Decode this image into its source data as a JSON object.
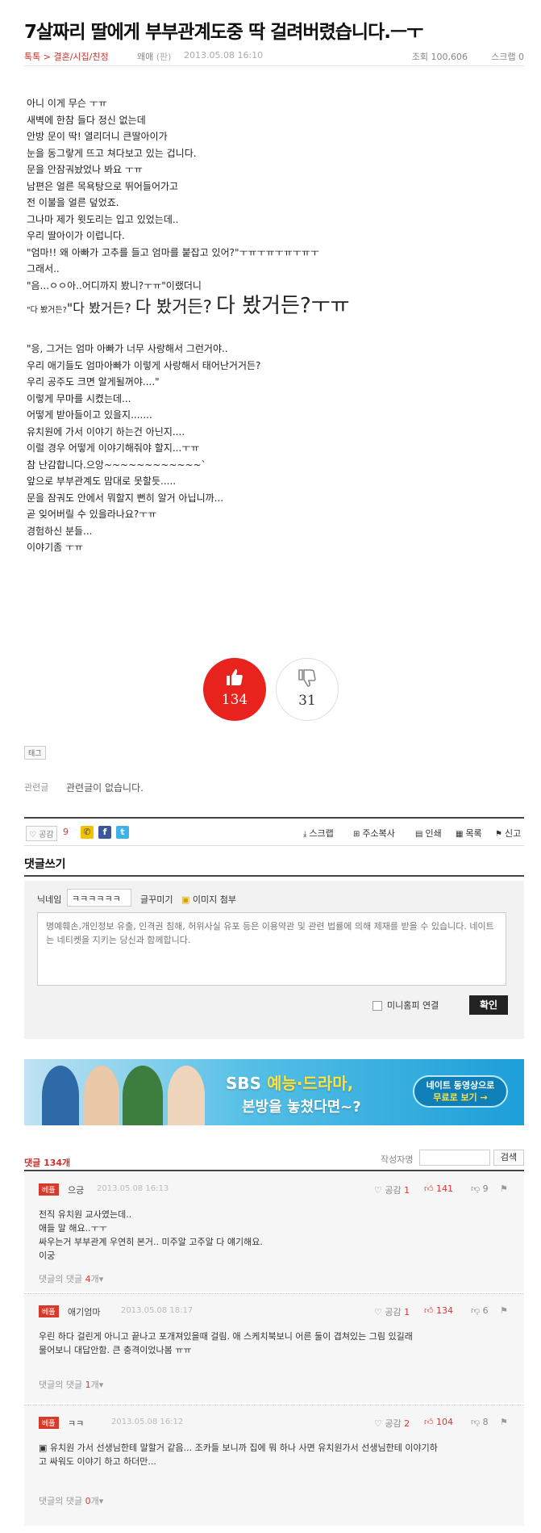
{
  "post": {
    "title": "7살짜리 딸에게 부부관계도중 딱 걸려버렸습니다.ㅡㅜ",
    "breadcrumb": "톡톡 > 결혼/시집/친정",
    "author": "왜애",
    "author_mark": "(판)",
    "date": "2013.05.08 16:10",
    "views": "조회 100,606",
    "scraps": "스크랩 0",
    "lines_1": [
      "아니 이게 무슨 ㅜㅠ",
      "새벽에 한참 들다 정신 없는데",
      "안방 문이 딱! 열리더니 큰딸아이가",
      "눈을 동그랗게 뜨고 쳐다보고 있는 겁니다.",
      "문을 안잠궈놨었나 봐요 ㅜㅠ",
      "남편은 얼른 목욕탕으로 뛰어들어가고",
      "전 이불을 얼른 덮었죠.",
      "그나마 제가 윗도리는 입고 있었는데..",
      "우리 딸아이가 이럽니다.",
      "\"엄마!! 왜 아빠가 고추를 들고 엄마를 붙잡고 있어?\"ㅜㅠㅜㅠㅜㅠㅜㅠㅜ",
      "그래서..",
      "\"음...ㅇㅇ아..어디까지 봤니?ㅜㅠ\"이랬더니"
    ],
    "growing": [
      "\"다 봤거든?",
      "\"다 봤거든?",
      "다 봤거든?",
      "다 봤거든?ㅜㅠ"
    ],
    "lines_2": [
      "\"응, 그거는 엄마 아빠가 너무 사랑해서 그런거야..",
      " 우리 애기들도 엄마아빠가 이렇게 사랑해서 태어난거거든?",
      " 우리 공주도 크면 알게될꺼야....\"",
      "  이렇게 무마를 시켰는데...",
      "어떻게 받아들이고 있을지.......",
      "유치원에 가서 이야기 하는건 아닌지....",
      "이럴 경우 어떻게 이야기해줘야 할지...ㅜㅠ",
      "참 난감합니다.으앙~~~~~~~~~~~~`",
      "앞으로 부부관계도 맘대로 못할듯.....",
      "문을 잠궈도 안에서 뭐할지 뻔히 알거 아닙니까...",
      "곧 잊어버릴 수 있을라나요?ㅜㅠ",
      "경험하신 분들...",
      "이야기좀 ㅜㅠ"
    ]
  },
  "votes": {
    "up": "134",
    "down": "31"
  },
  "tag_label": "태그",
  "related": {
    "label": "관련글",
    "text": "관련글이 없습니다."
  },
  "share": {
    "like_label": "공감",
    "like_count": "9",
    "scrap": "스크랩",
    "copy_url": "주소복사",
    "print": "인쇄",
    "list": "목록",
    "report": "신고"
  },
  "comment_write": {
    "title": "댓글쓰기",
    "nick_label": "닉네임",
    "nick_value": "ㅋㅋㅋㅋㅋㅋ",
    "format_label": "글꾸미기",
    "image_label": "이미지 첨부",
    "placeholder": "명예훼손,개인정보 유출, 인격권 침해, 허위사실 유포 등은 이용약관 및 관련 법률에 의해 제재를 받을 수 있습니다. 네이트는 네티켓을 지키는 당신과 함께합니다.",
    "minihp_label": "미니홈피 연결",
    "confirm": "확인"
  },
  "banner": {
    "main_a": "SBS ",
    "main_b": "예능·드라마,",
    "sub": "본방을 놓쳤다면~?",
    "btn_line1": "네이트 동영상으로",
    "btn_line2": "무료로 보기 →"
  },
  "comments_header": {
    "count": "댓글 134개",
    "search_label": "작성자명",
    "search_btn": "검색"
  },
  "comments": [
    {
      "badge": "베플",
      "nick": "으긍",
      "date": "2013.05.08 16:13",
      "gong_label": "공감",
      "gong": "1",
      "up": "141",
      "down": "9",
      "lines": [
        "전직 유치원 교사였는데..",
        "애들 말 해요..ㅜㅜ",
        "싸우는거 부부관계 우연히 본거.. 미주알 고주알 다 얘기해요.",
        "이궁"
      ],
      "reply_label": "댓글의 댓글",
      "reply_count": "4",
      "reply_unit": "개"
    },
    {
      "badge": "베플",
      "nick": "애기엄마",
      "date": "2013.05.08 18:17",
      "gong_label": "공감",
      "gong": "1",
      "up": "134",
      "down": "6",
      "lines": [
        "우린 하다 걸린게 아니고 끝나고 포개져있을때 걸림. 애 스케치북보니 어른 둘이 겹쳐있는 그림 있길래",
        "물어보니 대답안함. 큰 충격이었나봄 ㅠㅠ"
      ],
      "reply_label": "댓글의 댓글",
      "reply_count": "1",
      "reply_unit": "개"
    },
    {
      "badge": "베플",
      "nick": "ㅋㅋ",
      "date": "2013.05.08 16:12",
      "gong_label": "공감",
      "gong": "2",
      "up": "104",
      "down": "8",
      "lines": [
        "▣ 유치원 가서 선생님한테 말할거 같음... 조카들 보니까 집에 뭐 하나 사면 유치원가서 선생님한테 이야기하",
        "고 싸워도 이야기 하고 하더만..."
      ],
      "reply_label": "댓글의 댓글",
      "reply_count": "0",
      "reply_unit": "개"
    }
  ],
  "colors": {
    "accent": "#c8322b",
    "vote_up": "#e8231e",
    "banner": "#1d9fd8"
  },
  "icons": [
    "thumbs-up-icon",
    "thumbs-down-icon",
    "heart-icon",
    "facebook-icon",
    "twitter-icon",
    "print-icon",
    "list-icon",
    "report-icon",
    "image-icon",
    "paint-icon"
  ]
}
